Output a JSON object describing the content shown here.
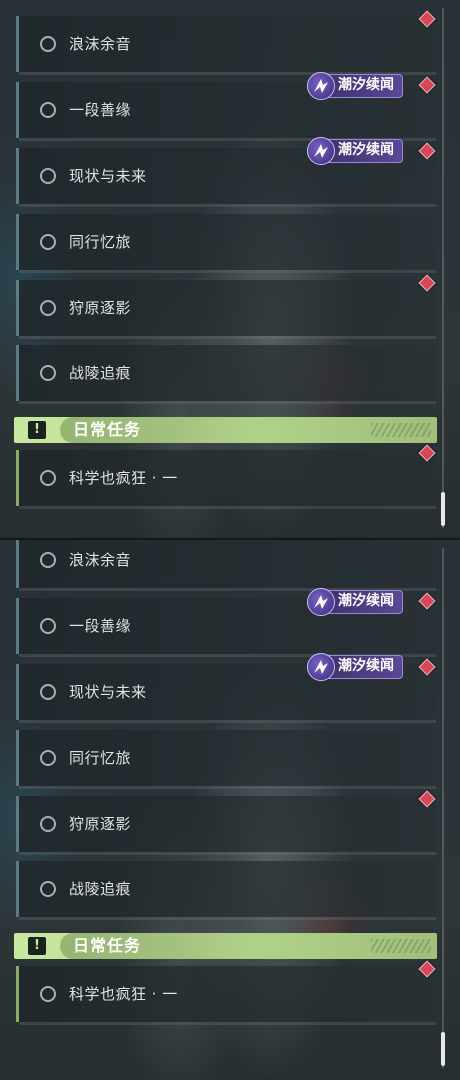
{
  "quests": [
    {
      "label": "浪沫余音"
    },
    {
      "label": "一段善缘",
      "tag": "潮汐续闻"
    },
    {
      "label": "现状与未来",
      "tag": "潮汐续闻"
    },
    {
      "label": "同行忆旅"
    },
    {
      "label": "狩原逐影"
    },
    {
      "label": "战陵追痕"
    }
  ],
  "daily": {
    "section_title": "日常任务",
    "section_icon": "!",
    "quest": {
      "label": "科学也疯狂 · 一"
    }
  },
  "icons": {
    "quest_status": "circle-outline-icon",
    "tracker": "red-diamond-icon",
    "tag": "tidal-sequel-icon",
    "section": "exclamation-icon"
  },
  "colors": {
    "quest_border": "#5d7b87",
    "daily_border": "#8cab6a",
    "diamond": "#d54858",
    "tag_bg": "#5a4796",
    "section_bg": "#c9e9a0"
  }
}
